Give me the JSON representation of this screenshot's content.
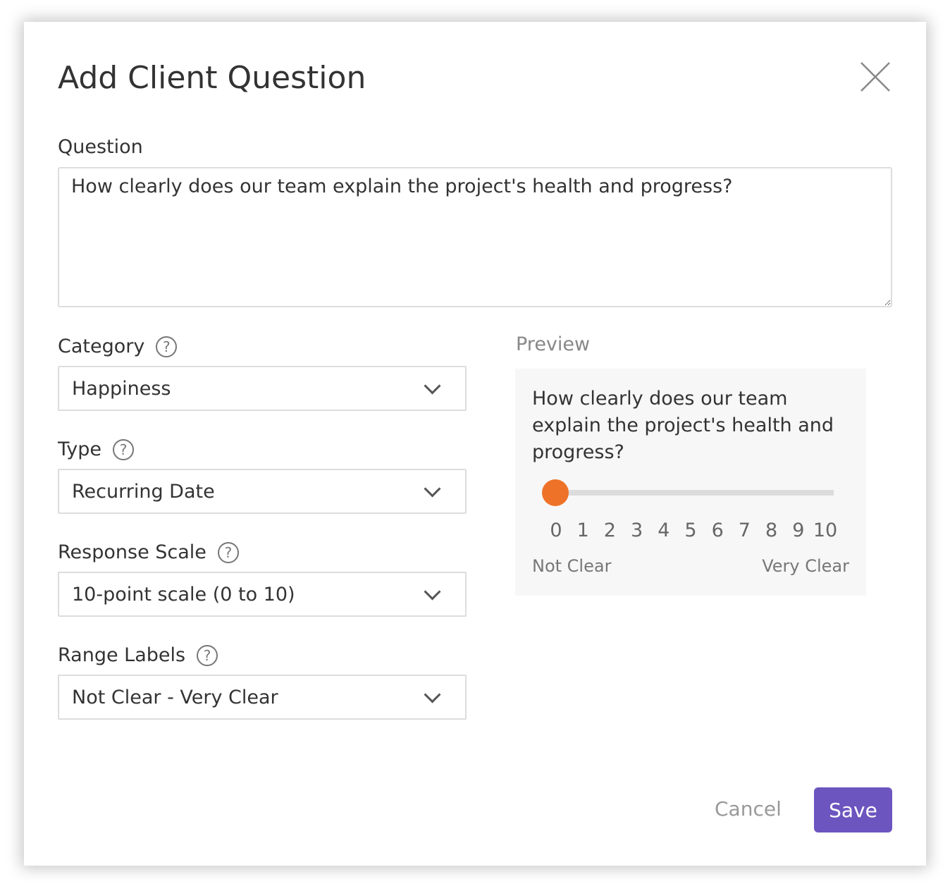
{
  "dialog": {
    "title": "Add Client Question"
  },
  "question": {
    "label": "Question",
    "value": "How clearly does our team explain the project's health and progress?"
  },
  "fields": [
    {
      "label": "Category",
      "value": "Happiness"
    },
    {
      "label": "Type",
      "value": "Recurring Date"
    },
    {
      "label": "Response Scale",
      "value": "10-point scale (0 to 10)"
    },
    {
      "label": "Range Labels",
      "value": "Not Clear - Very Clear"
    }
  ],
  "help_glyph": "?",
  "preview": {
    "label": "Preview",
    "question": "How clearly does our team explain the project's health and progress?",
    "scale": [
      "0",
      "1",
      "2",
      "3",
      "4",
      "5",
      "6",
      "7",
      "8",
      "9",
      "10"
    ],
    "slider_value": 0,
    "low_label": "Not Clear",
    "high_label": "Very Clear",
    "thumb_color": "#ee7328"
  },
  "actions": {
    "cancel": "Cancel",
    "save": "Save",
    "save_color": "#6c55bf"
  }
}
